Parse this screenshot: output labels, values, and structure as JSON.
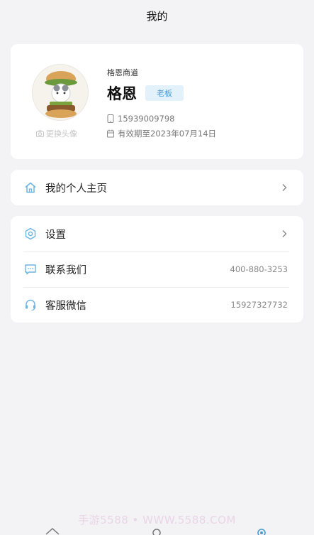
{
  "header": {
    "title": "我的"
  },
  "profile": {
    "shop_name": "格恩商道",
    "user_name": "格恩",
    "role": "老板",
    "change_avatar": "更换头像",
    "phone": "15939009798",
    "expiry": "有效期至2023年07月14日"
  },
  "menu_top": {
    "homepage_label": "我的个人主页"
  },
  "menu_main": {
    "settings_label": "设置",
    "contact_label": "联系我们",
    "contact_value": "400-880-3253",
    "wechat_label": "客服微信",
    "wechat_value": "15927327732"
  },
  "watermark": "手游5588 • WWW.5588.COM",
  "colors": {
    "accent": "#4a9bd6",
    "icon": "#6bb3e0",
    "background": "#f3f3f5"
  }
}
